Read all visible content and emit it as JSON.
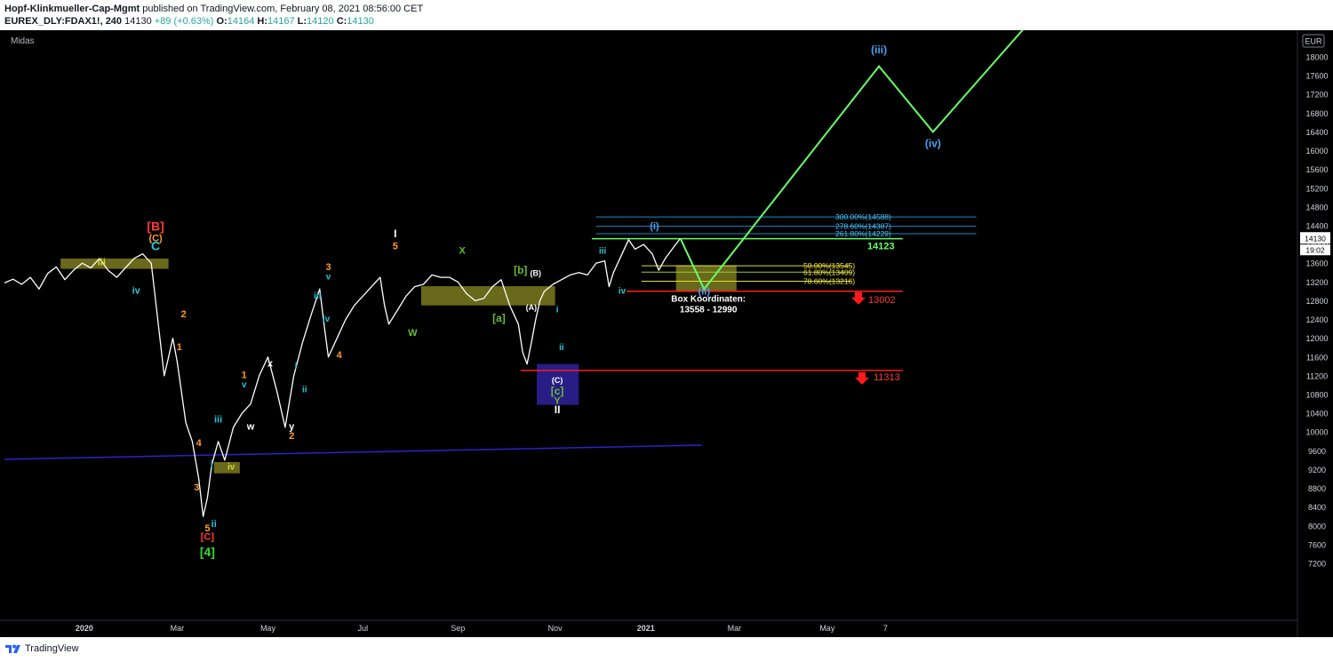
{
  "header": {
    "author": "Hopf-Klinkmueller-Cap-Mgmt",
    "published": "published on TradingView.com, February 08, 2021 08:56:00 CET",
    "symbol": "EUREX_DLY:FDAX1!, 240",
    "last": "14130",
    "change": "+89 (+0.63%)",
    "o_label": "O:",
    "o_value": "14164",
    "h_label": "H:",
    "h_value": "14167",
    "l_label": "L:",
    "l_value": "14120",
    "c_label": "C:",
    "c_value": "14130"
  },
  "indicator_label": "Midas",
  "footer": {
    "brand": "TradingView"
  },
  "colors": {
    "background": "#000000",
    "price": "#ffffff",
    "projection": "#66ff66",
    "support": "#ff1a1a",
    "fib": "#1e88c8",
    "midas": "#2b23c8",
    "zone": "#7d7a1e",
    "zone_blue": "#2a1e8c"
  },
  "chart_data": {
    "type": "line",
    "currency": "EUR",
    "ylim": [
      7000,
      18600
    ],
    "yticks": [
      7200,
      7600,
      8000,
      8400,
      8800,
      9200,
      9600,
      10000,
      10400,
      10800,
      11200,
      11600,
      12000,
      12400,
      12800,
      13200,
      13600,
      14000,
      14400,
      14800,
      15200,
      15600,
      16000,
      16400,
      16800,
      17200,
      17600,
      18000
    ],
    "xticks": [
      "2020",
      "Mar",
      "May",
      "Jul",
      "Sep",
      "Nov",
      "2021",
      "Mar",
      "May",
      "7"
    ],
    "last_price": "14130",
    "countdown": "19:02",
    "series": [
      {
        "values": [
          [
            0,
            13180
          ],
          [
            0.4,
            13260
          ],
          [
            0.8,
            13150
          ],
          [
            1.2,
            13300
          ],
          [
            1.6,
            13050
          ],
          [
            2,
            13380
          ],
          [
            2.4,
            13520
          ],
          [
            2.8,
            13250
          ],
          [
            3.2,
            13450
          ],
          [
            3.6,
            13600
          ],
          [
            4,
            13500
          ],
          [
            4.4,
            13700
          ],
          [
            4.8,
            13450
          ],
          [
            5.2,
            13300
          ],
          [
            5.6,
            13500
          ],
          [
            6,
            13700
          ],
          [
            6.4,
            13800
          ],
          [
            6.8,
            13600
          ],
          [
            7,
            12800
          ],
          [
            7.4,
            11200
          ],
          [
            7.6,
            11600
          ],
          [
            7.8,
            12000
          ],
          [
            8,
            11500
          ],
          [
            8.4,
            10200
          ],
          [
            8.7,
            9800
          ],
          [
            9,
            9000
          ],
          [
            9.2,
            8200
          ],
          [
            9.4,
            8600
          ],
          [
            9.6,
            9300
          ],
          [
            9.9,
            9800
          ],
          [
            10.2,
            9400
          ],
          [
            10.6,
            10100
          ],
          [
            11,
            10400
          ],
          [
            11.4,
            10600
          ],
          [
            11.8,
            11200
          ],
          [
            12.2,
            11600
          ],
          [
            12.6,
            10900
          ],
          [
            13,
            10100
          ],
          [
            13.4,
            11200
          ],
          [
            13.8,
            11900
          ],
          [
            14.2,
            12500
          ],
          [
            14.6,
            13050
          ],
          [
            14.8,
            12300
          ],
          [
            15,
            11600
          ],
          [
            15.4,
            12000
          ],
          [
            15.8,
            12400
          ],
          [
            16.2,
            12700
          ],
          [
            16.6,
            12900
          ],
          [
            17,
            13100
          ],
          [
            17.4,
            13300
          ],
          [
            17.6,
            12700
          ],
          [
            17.8,
            12300
          ],
          [
            18.2,
            12600
          ],
          [
            18.6,
            12900
          ],
          [
            19,
            13100
          ],
          [
            19.4,
            13150
          ],
          [
            19.8,
            13350
          ],
          [
            20.2,
            13300
          ],
          [
            20.6,
            13300
          ],
          [
            21,
            13200
          ],
          [
            21.4,
            12950
          ],
          [
            21.8,
            12800
          ],
          [
            22.2,
            12850
          ],
          [
            22.6,
            13100
          ],
          [
            23,
            13250
          ],
          [
            23.4,
            12700
          ],
          [
            23.8,
            12300
          ],
          [
            24,
            11700
          ],
          [
            24.2,
            11450
          ],
          [
            24.4,
            11900
          ],
          [
            24.6,
            12400
          ],
          [
            24.8,
            12800
          ],
          [
            25,
            13000
          ],
          [
            25.4,
            13150
          ],
          [
            25.8,
            13250
          ],
          [
            26.2,
            13350
          ],
          [
            26.6,
            13400
          ],
          [
            27,
            13350
          ],
          [
            27.4,
            13600
          ],
          [
            27.8,
            13650
          ],
          [
            28,
            13100
          ],
          [
            28.2,
            13400
          ],
          [
            28.6,
            13800
          ],
          [
            28.9,
            14100
          ],
          [
            29.2,
            13900
          ],
          [
            29.6,
            14000
          ],
          [
            30,
            13800
          ],
          [
            30.3,
            13450
          ],
          [
            30.6,
            13700
          ],
          [
            31,
            13950
          ],
          [
            31.3,
            14130
          ]
        ]
      }
    ],
    "projection_path": [
      [
        31.3,
        14130
      ],
      [
        32.4,
        13050
      ],
      [
        40.5,
        17800
      ],
      [
        43,
        16400
      ],
      [
        47.2,
        18600
      ]
    ],
    "horizontal_levels": [
      {
        "value": 14123,
        "label": "14123"
      },
      {
        "value": 13002,
        "label": "13002"
      },
      {
        "value": 11313,
        "label": "11313"
      }
    ],
    "fib_levels": [
      {
        "value": 14588,
        "label": "300.00%(14588)"
      },
      {
        "value": 14387,
        "label": "278.60%(14387)"
      },
      {
        "value": 14229,
        "label": "261.80%(14229)"
      },
      {
        "value": 13545,
        "label": "50.00%(13545)"
      },
      {
        "value": 13409,
        "label": "61.80%(13409)"
      },
      {
        "value": 13216,
        "label": "78.60%(13216)"
      }
    ],
    "annotations": {
      "box_title": "Box Koordinaten:",
      "box_range": "13558 - 12990",
      "wave_labels": [
        {
          "text": "[B]",
          "x": 7.0,
          "y": 14300,
          "color": "#ff3b3b",
          "size": 14
        },
        {
          "text": "(C)",
          "x": 7.0,
          "y": 14070,
          "color": "#ff9a2e",
          "size": 11
        },
        {
          "text": "C",
          "x": 7.0,
          "y": 13880,
          "color": "#26c6da",
          "size": 14
        },
        {
          "text": "iii",
          "x": 4.5,
          "y": 13560,
          "color": "#cddc39",
          "size": 11
        },
        {
          "text": "iv",
          "x": 6.1,
          "y": 12950,
          "color": "#26c6da",
          "size": 11
        },
        {
          "text": "2",
          "x": 8.3,
          "y": 12450,
          "color": "#ff9a2e",
          "size": 11
        },
        {
          "text": "1",
          "x": 8.1,
          "y": 11750,
          "color": "#ff9a2e",
          "size": 11
        },
        {
          "text": "4",
          "x": 9.0,
          "y": 9700,
          "color": "#ff9a2e",
          "size": 11
        },
        {
          "text": "3",
          "x": 8.9,
          "y": 8750,
          "color": "#ff9a2e",
          "size": 11
        },
        {
          "text": "5",
          "x": 9.4,
          "y": 7880,
          "color": "#ff9a2e",
          "size": 11
        },
        {
          "text": "[C]",
          "x": 9.4,
          "y": 7700,
          "color": "#ff3b3b",
          "size": 11
        },
        {
          "text": "[4]",
          "x": 9.4,
          "y": 7350,
          "color": "#33dd33",
          "size": 14
        },
        {
          "text": "ii",
          "x": 9.7,
          "y": 7980,
          "color": "#26c6da",
          "size": 11
        },
        {
          "text": "i",
          "x": 9.6,
          "y": 9250,
          "color": "#26c6da",
          "size": 11
        },
        {
          "text": "iii",
          "x": 9.9,
          "y": 10200,
          "color": "#26c6da",
          "size": 11
        },
        {
          "text": "iv",
          "x": 10.5,
          "y": 9200,
          "color": "#cddc39",
          "size": 10
        },
        {
          "text": "1",
          "x": 11.1,
          "y": 11150,
          "color": "#ff9a2e",
          "size": 11
        },
        {
          "text": "v",
          "x": 11.1,
          "y": 10950,
          "color": "#26c6da",
          "size": 10
        },
        {
          "text": "w",
          "x": 11.4,
          "y": 10050,
          "color": "#ffffff",
          "size": 11
        },
        {
          "text": "x",
          "x": 12.3,
          "y": 11400,
          "color": "#ffffff",
          "size": 11
        },
        {
          "text": "y",
          "x": 13.3,
          "y": 10050,
          "color": "#ffffff",
          "size": 11
        },
        {
          "text": "2",
          "x": 13.3,
          "y": 9850,
          "color": "#ff9a2e",
          "size": 11
        },
        {
          "text": "i",
          "x": 13.5,
          "y": 11350,
          "color": "#26c6da",
          "size": 10
        },
        {
          "text": "ii",
          "x": 13.9,
          "y": 10850,
          "color": "#26c6da",
          "size": 10
        },
        {
          "text": "3",
          "x": 15.0,
          "y": 13450,
          "color": "#ff9a2e",
          "size": 11
        },
        {
          "text": "v",
          "x": 15.0,
          "y": 13250,
          "color": "#26c6da",
          "size": 10
        },
        {
          "text": "iii",
          "x": 14.5,
          "y": 12850,
          "color": "#26c6da",
          "size": 10
        },
        {
          "text": "iv",
          "x": 14.9,
          "y": 12350,
          "color": "#26c6da",
          "size": 10
        },
        {
          "text": "4",
          "x": 15.5,
          "y": 11580,
          "color": "#ff9a2e",
          "size": 11
        },
        {
          "text": "I",
          "x": 18.1,
          "y": 14150,
          "color": "#ffffff",
          "size": 12
        },
        {
          "text": "5",
          "x": 18.1,
          "y": 13900,
          "color": "#ff9a2e",
          "size": 11
        },
        {
          "text": "W",
          "x": 18.9,
          "y": 12050,
          "color": "#66bb33",
          "size": 11
        },
        {
          "text": "X",
          "x": 21.2,
          "y": 13800,
          "color": "#66bb33",
          "size": 11
        },
        {
          "text": "[b]",
          "x": 23.9,
          "y": 13380,
          "color": "#66bb33",
          "size": 12
        },
        {
          "text": "(B)",
          "x": 24.6,
          "y": 13330,
          "color": "#ffffff",
          "size": 9
        },
        {
          "text": "[a]",
          "x": 22.9,
          "y": 12350,
          "color": "#66bb33",
          "size": 12
        },
        {
          "text": "(A)",
          "x": 24.4,
          "y": 12600,
          "color": "#ffffff",
          "size": 9
        },
        {
          "text": "i",
          "x": 25.6,
          "y": 12550,
          "color": "#26c6da",
          "size": 10
        },
        {
          "text": "ii",
          "x": 25.8,
          "y": 11750,
          "color": "#26c6da",
          "size": 10
        },
        {
          "text": "(C)",
          "x": 25.6,
          "y": 11050,
          "color": "#ffffff",
          "size": 9
        },
        {
          "text": "[c]",
          "x": 25.6,
          "y": 10800,
          "color": "#66bb33",
          "size": 12
        },
        {
          "text": "Y",
          "x": 25.6,
          "y": 10600,
          "color": "#66bb33",
          "size": 11
        },
        {
          "text": "II",
          "x": 25.6,
          "y": 10400,
          "color": "#ffffff",
          "size": 12
        },
        {
          "text": "iii",
          "x": 27.7,
          "y": 13800,
          "color": "#26c6da",
          "size": 10
        },
        {
          "text": "iv",
          "x": 28.6,
          "y": 12950,
          "color": "#26c6da",
          "size": 10
        },
        {
          "text": "(i)",
          "x": 30.1,
          "y": 14320,
          "color": "#42a5f5",
          "size": 11
        },
        {
          "text": "(ii)",
          "x": 32.4,
          "y": 12930,
          "color": "#42a5f5",
          "size": 11
        },
        {
          "text": "(iii)",
          "x": 40.5,
          "y": 18080,
          "color": "#42a5f5",
          "size": 12
        },
        {
          "text": "(iv)",
          "x": 43.0,
          "y": 16080,
          "color": "#42a5f5",
          "size": 12
        }
      ]
    },
    "midas_line": [
      [
        0,
        9420
      ],
      [
        32.3,
        9720
      ]
    ]
  }
}
